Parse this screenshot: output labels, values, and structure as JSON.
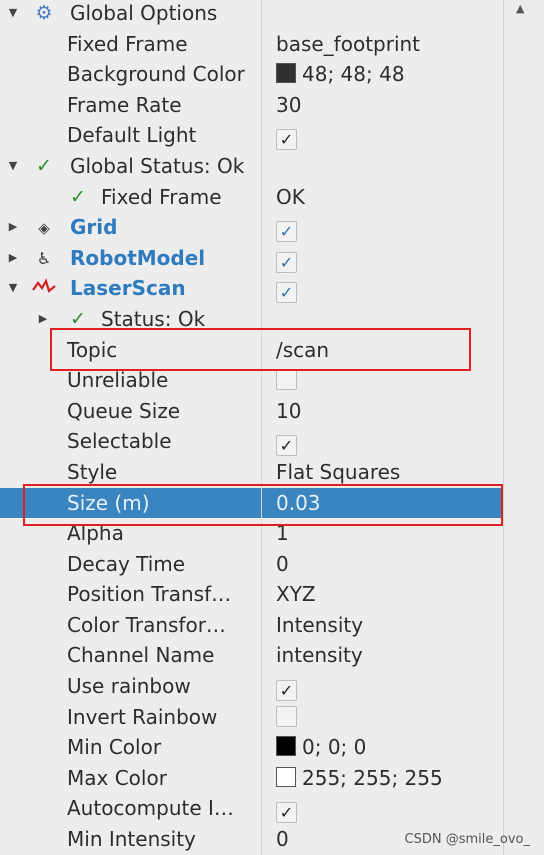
{
  "rows": [
    {
      "label": "Global Options",
      "value": "",
      "level": 0,
      "arrow": "down",
      "icon": "gear-icon",
      "display": false
    },
    {
      "label": "Fixed Frame",
      "value": "base_footprint",
      "level": 1
    },
    {
      "label": "Background Color",
      "value": "48; 48; 48",
      "level": 1,
      "swatch": "#303030"
    },
    {
      "label": "Frame Rate",
      "value": "30",
      "level": 1
    },
    {
      "label": "Default Light",
      "value": "",
      "level": 1,
      "checkbox": true,
      "checked": true
    },
    {
      "label": "Global Status: Ok",
      "value": "",
      "level": 0,
      "arrow": "down",
      "icon": "check-icon"
    },
    {
      "label": "Fixed Frame",
      "value": "OK",
      "level": 1,
      "icon": "check-icon"
    },
    {
      "label": "Grid",
      "value": "",
      "level": 0,
      "arrow": "right",
      "icon": "grid-icon",
      "display": true,
      "checkbox": true,
      "checked": true,
      "cbStyle": "blue"
    },
    {
      "label": "RobotModel",
      "value": "",
      "level": 0,
      "arrow": "right",
      "icon": "robot-icon",
      "display": true,
      "checkbox": true,
      "checked": true,
      "cbStyle": "blue"
    },
    {
      "label": "LaserScan",
      "value": "",
      "level": 0,
      "arrow": "down",
      "icon": "laserscan-icon",
      "display": true,
      "checkbox": true,
      "checked": true,
      "cbStyle": "blue"
    },
    {
      "label": "Status: Ok",
      "value": "",
      "level": 1,
      "arrow": "right",
      "icon": "check-icon"
    },
    {
      "label": "Topic",
      "value": "/scan",
      "level": 1
    },
    {
      "label": "Unreliable",
      "value": "",
      "level": 1,
      "checkbox": true,
      "checked": false
    },
    {
      "label": "Queue Size",
      "value": "10",
      "level": 1
    },
    {
      "label": "Selectable",
      "value": "",
      "level": 1,
      "checkbox": true,
      "checked": true
    },
    {
      "label": "Style",
      "value": "Flat Squares",
      "level": 1
    },
    {
      "label": "Size (m)",
      "value": "0.03",
      "level": 1,
      "selected": true
    },
    {
      "label": "Alpha",
      "value": "1",
      "level": 1
    },
    {
      "label": "Decay Time",
      "value": "0",
      "level": 1
    },
    {
      "label": "Position Transf…",
      "value": "XYZ",
      "level": 1
    },
    {
      "label": "Color Transfor…",
      "value": "Intensity",
      "level": 1
    },
    {
      "label": "Channel Name",
      "value": "intensity",
      "level": 1
    },
    {
      "label": "Use rainbow",
      "value": "",
      "level": 1,
      "checkbox": true,
      "checked": true
    },
    {
      "label": "Invert Rainbow",
      "value": "",
      "level": 1,
      "checkbox": true,
      "checked": false
    },
    {
      "label": "Min Color",
      "value": "0; 0; 0",
      "level": 1,
      "swatch": "#000000"
    },
    {
      "label": "Max Color",
      "value": "255; 255; 255",
      "level": 1,
      "swatch": "#ffffff"
    },
    {
      "label": "Autocompute I…",
      "value": "",
      "level": 1,
      "checkbox": true,
      "checked": true
    },
    {
      "label": "Min Intensity",
      "value": "0",
      "level": 1
    }
  ],
  "colors": {
    "selection": "#3a85c0",
    "display_label": "#2f7bbf",
    "highlight_box": "#e02020",
    "status_ok": "#2e8b2e"
  },
  "watermark": "CSDN @smile_ovo_"
}
